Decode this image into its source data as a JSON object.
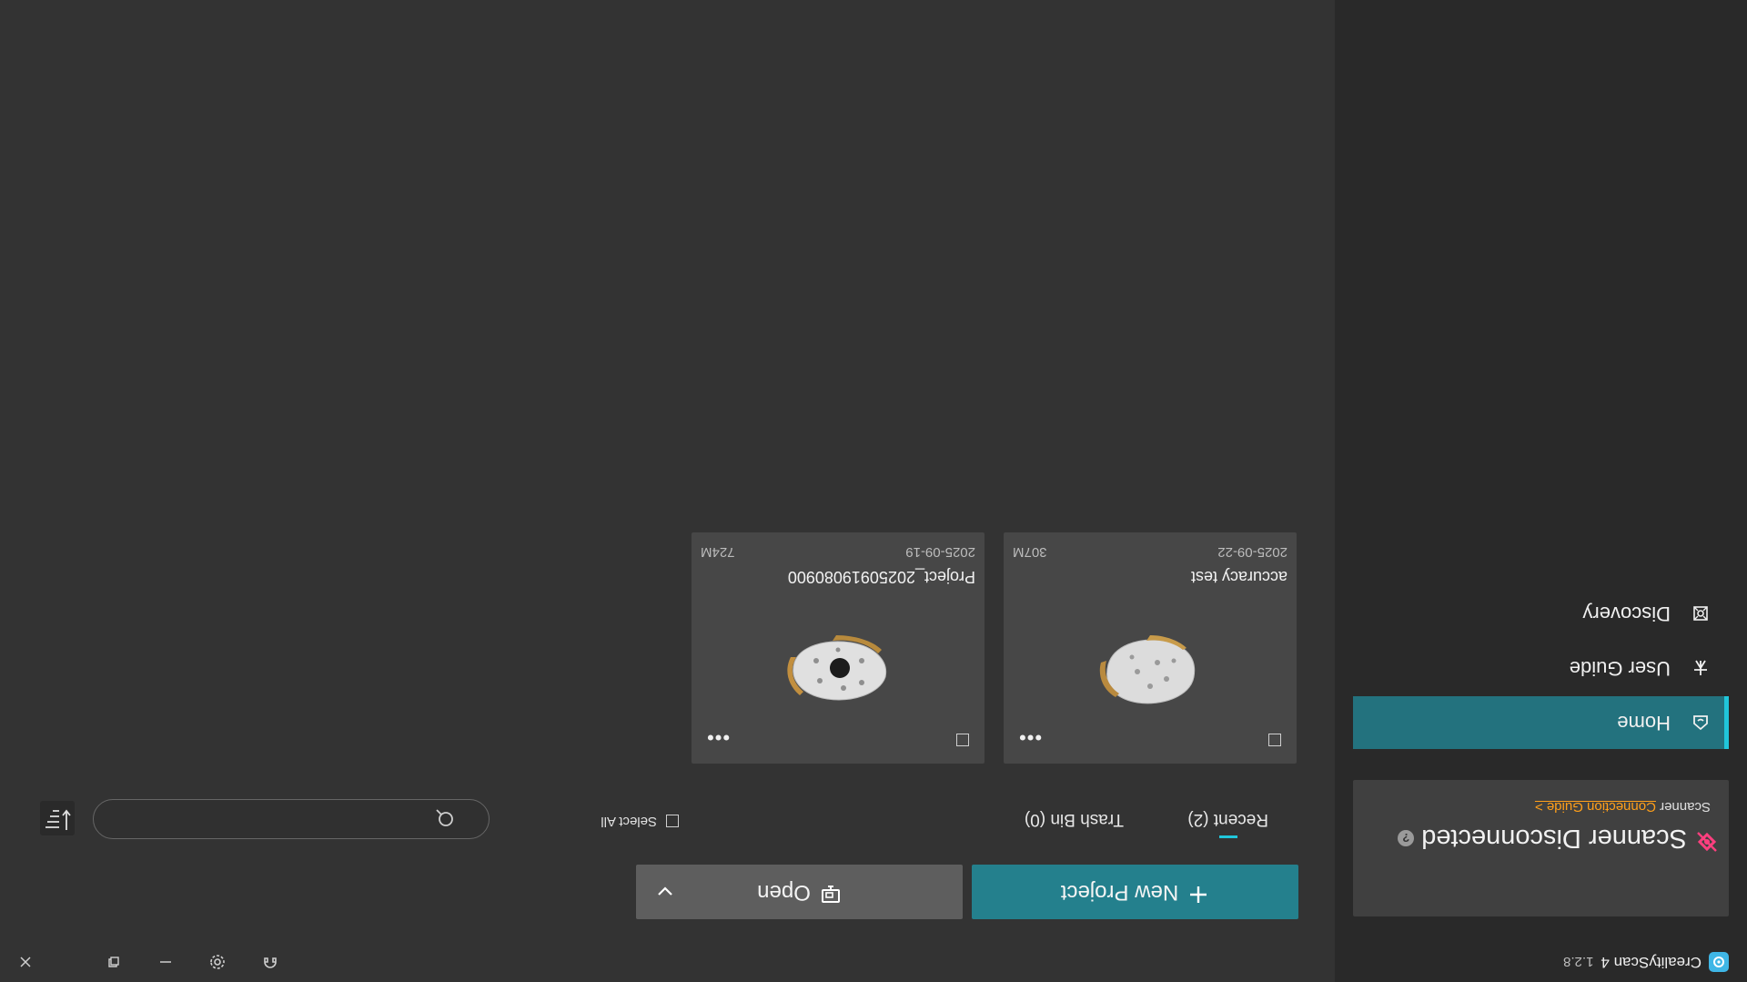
{
  "app": {
    "name": "CrealityScan 4",
    "version": "1.2.8"
  },
  "sidebar": {
    "scanner": {
      "status": "Scanner Disconnected",
      "help_glyph": "?",
      "guide_prefix": "Scanner",
      "guide_link": "Connection Guide >"
    },
    "items": [
      {
        "label": "Home",
        "icon": "home-icon",
        "active": true
      },
      {
        "label": "User Guide",
        "icon": "user-guide-icon",
        "active": false
      },
      {
        "label": "Discovery",
        "icon": "discovery-icon",
        "active": false
      }
    ]
  },
  "toolbar": {
    "new_project_label": "New Project",
    "open_label": "Open"
  },
  "tabs": [
    {
      "label": "Recent (2)",
      "active": true
    },
    {
      "label": "Trash Bin (0)",
      "active": false
    }
  ],
  "select_all_label": "Select All",
  "search": {
    "placeholder": ""
  },
  "projects": [
    {
      "name": "accuracy test",
      "date": "2025-09-22",
      "size": "307M"
    },
    {
      "name": "Project_20250919080900",
      "date": "2025-09-19",
      "size": "724M"
    }
  ],
  "colors": {
    "accent": "#24808d",
    "accent_bright": "#20c6da",
    "warning_link": "#ff9f1a",
    "disconnected": "#ff3f7f"
  }
}
